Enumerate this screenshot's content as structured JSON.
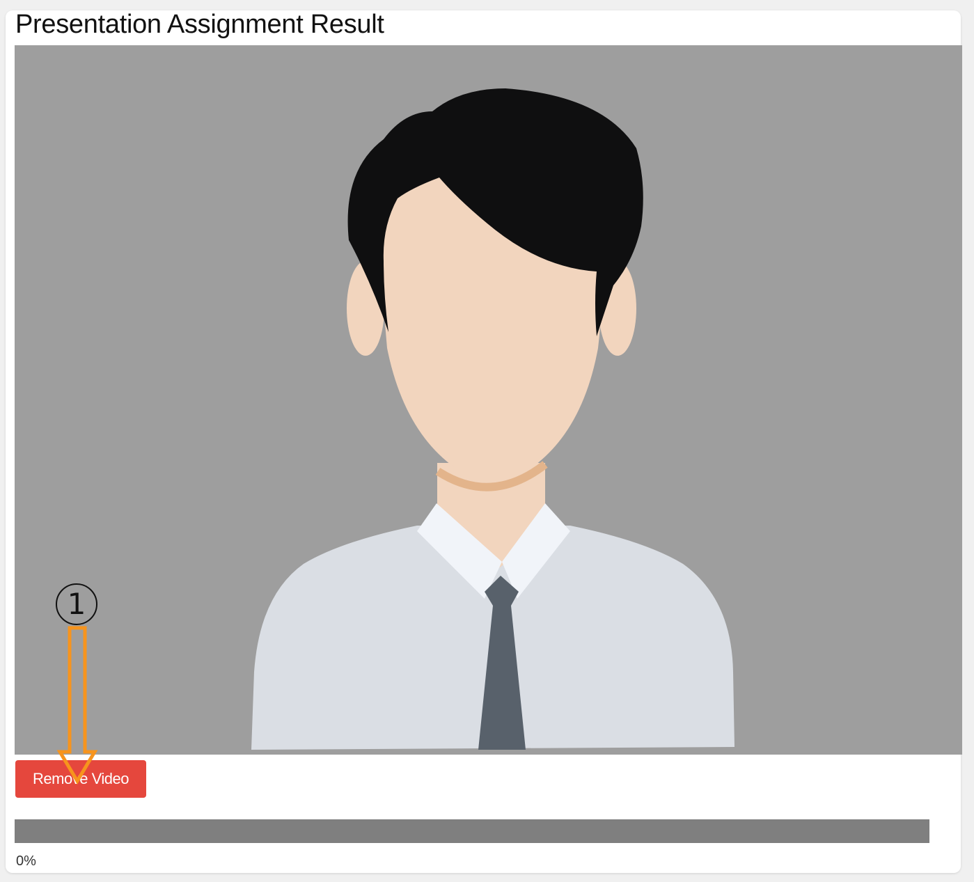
{
  "page": {
    "title": "Presentation Assignment Result"
  },
  "video": {
    "placeholder_icon": "person-avatar-icon",
    "background_color": "#9e9e9e"
  },
  "actions": {
    "remove_video_label": "Remove Video",
    "remove_video_color": "#e5473d"
  },
  "upload": {
    "progress_percent": 0,
    "progress_label": "0%"
  },
  "annotation": {
    "step_number": "1",
    "arrow_color": "#f7941d"
  }
}
